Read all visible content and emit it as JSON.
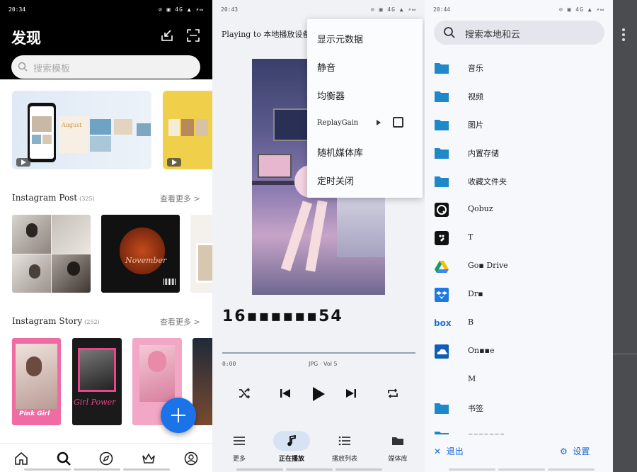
{
  "panel_discover": {
    "status_time": "20:34",
    "status_icons": "⊘ ▣ 4G ▲ ⚡▭",
    "title": "发现",
    "search_placeholder": "搜索模板",
    "banner_text": "August",
    "sections": [
      {
        "title": "Instagram Post",
        "count": "(325)",
        "more": "查看更多 >"
      },
      {
        "title": "Instagram Story",
        "count": "(252)",
        "more": "查看更多 >"
      }
    ],
    "post_tile_text": "November",
    "story_tiles": [
      "Pink Girl",
      "Girl Power"
    ],
    "nav_icons": [
      "home-icon",
      "search-icon",
      "compass-icon",
      "crown-icon",
      "profile-icon"
    ]
  },
  "panel_player": {
    "status_time": "20:43",
    "status_icons": "⊘ ▣ 4G ▲ ⚡▭",
    "playing_to": "Playing to 本地播放设备",
    "track_title": "16▪▪▪▪▪▪54",
    "position": "0:00",
    "format": "JPG · Vol 5",
    "menu": [
      "显示元数据",
      "静音",
      "均衡器",
      "ReplayGain",
      "随机媒体库",
      "定时关闭"
    ],
    "tabs": [
      "更多",
      "正在播放",
      "播放列表",
      "媒体库"
    ]
  },
  "panel_library": {
    "status_time": "20:44",
    "status_icons": "⊘ ▣ 4G ▲ ⚡▭",
    "search_placeholder": "搜索本地和云",
    "items": [
      "音乐",
      "视频",
      "图片",
      "内置存储",
      "收藏文件夹",
      "Qobuz",
      "T",
      "Go▪ Drive",
      "Dr▪",
      "B",
      "On▪▪e",
      "M",
      "书签",
      "▪▪▪▪▪▪▪"
    ],
    "exit_label": "退出",
    "settings_label": "设置",
    "colors": {
      "accent": "#1967d2",
      "folder": "#1e88c8"
    }
  }
}
